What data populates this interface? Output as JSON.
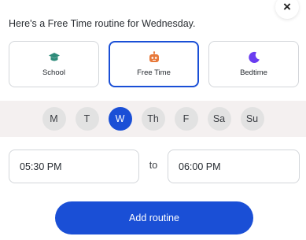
{
  "header": {
    "title": "Here's a Free Time routine for Wednesday.",
    "close_label": "×"
  },
  "routine_types": [
    {
      "label": "School",
      "icon": "graduation-cap-icon",
      "selected": false,
      "color": "#2e8b7a"
    },
    {
      "label": "Free Time",
      "icon": "robot-icon",
      "selected": true,
      "color": "#e8793a"
    },
    {
      "label": "Bedtime",
      "icon": "moon-icon",
      "selected": false,
      "color": "#6a3df0"
    }
  ],
  "days": [
    {
      "label": "M",
      "selected": false
    },
    {
      "label": "T",
      "selected": false
    },
    {
      "label": "W",
      "selected": true
    },
    {
      "label": "Th",
      "selected": false
    },
    {
      "label": "F",
      "selected": false
    },
    {
      "label": "Sa",
      "selected": false
    },
    {
      "label": "Su",
      "selected": false
    }
  ],
  "time": {
    "start": "05:30 PM",
    "separator": "to",
    "end": "06:00 PM"
  },
  "actions": {
    "add_label": "Add routine"
  },
  "colors": {
    "accent": "#1a4fd6",
    "day_band": "#f4f0f0"
  }
}
